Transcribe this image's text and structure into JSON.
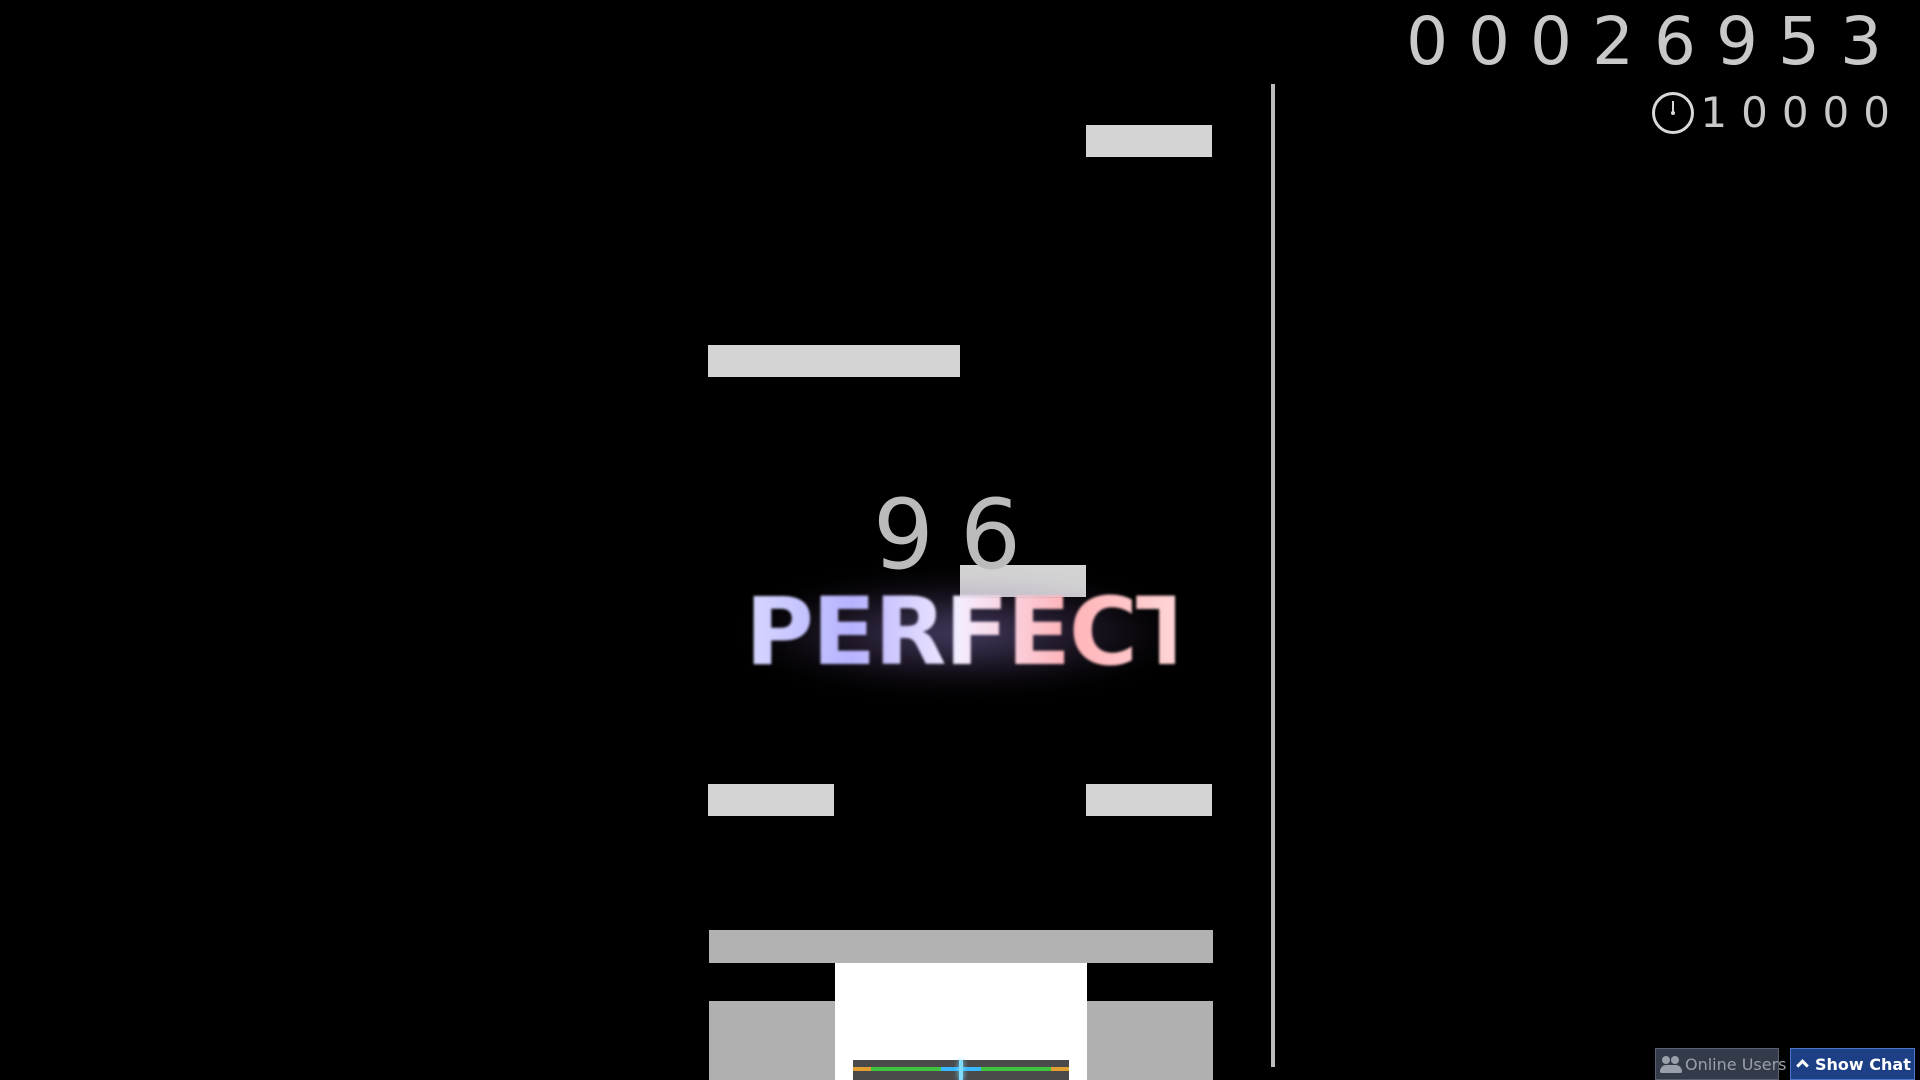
{
  "hud": {
    "score": "00026953",
    "accuracy": "10000",
    "accuracy_icon": "clock-icon"
  },
  "gameplay": {
    "combo": "96",
    "judgement": "PERFECT",
    "lane_count": 4
  },
  "footer": {
    "online_users_label": "Online Users",
    "online_users_icon": "users-icon",
    "show_chat_label": "Show Chat",
    "show_chat_icon": "chevron-up-icon",
    "show_chat_color": "#1d3f86"
  },
  "colors": {
    "background": "#000000",
    "note": "#d4d4d4",
    "receptor": "#b2b2b2",
    "judgement_left": "#b7b3ff",
    "judgement_right": "#ffb3b8",
    "hit_good": "#3fc43f",
    "hit_ok": "#e0a030",
    "hit_perfect": "#39b7ff"
  }
}
